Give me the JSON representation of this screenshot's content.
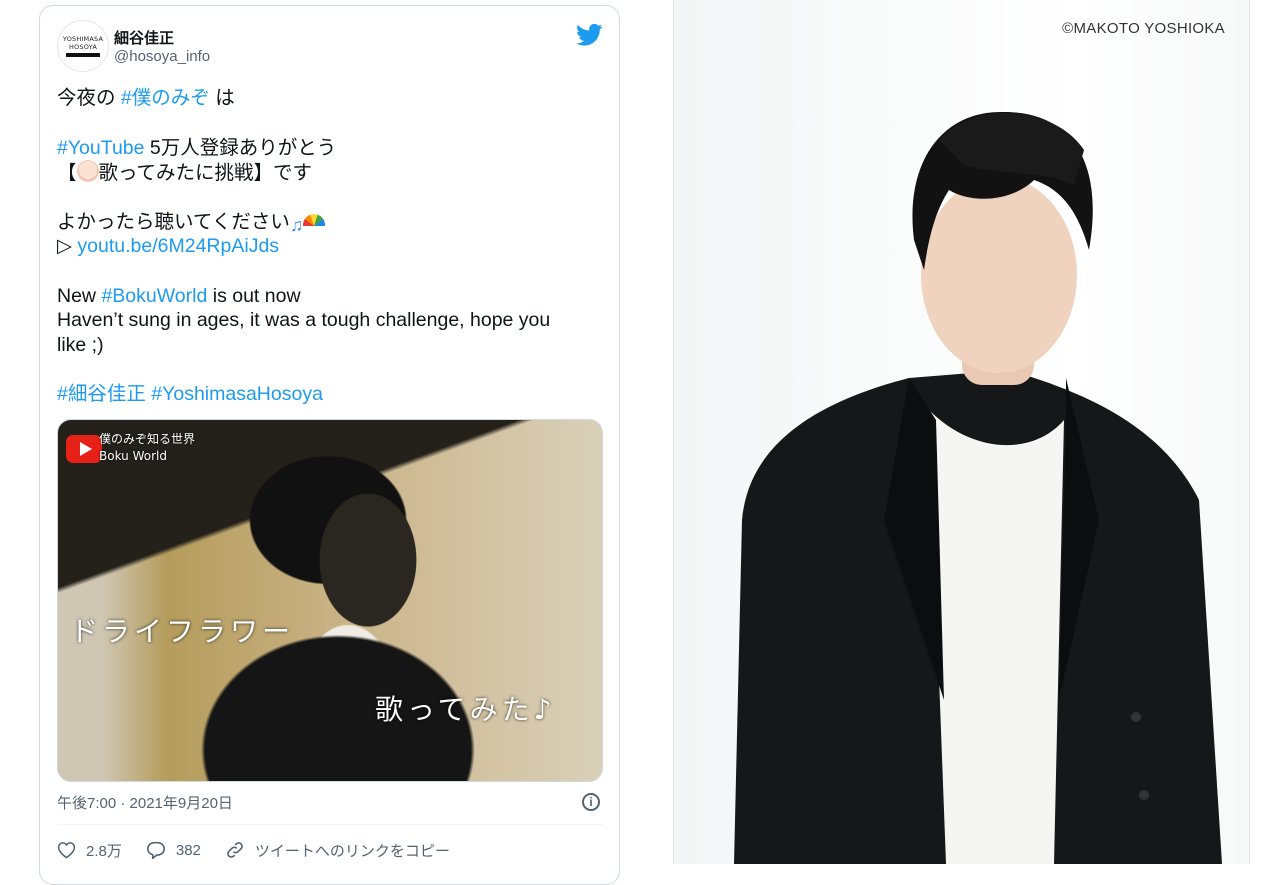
{
  "tweet": {
    "avatar": {
      "line1": "YOSHIMASA",
      "line2": "HOSOYA"
    },
    "display_name": "細谷佳正",
    "handle": "@hosoya_info",
    "lines": [
      {
        "parts": [
          {
            "t": "今夜の "
          },
          {
            "t": "#僕のみぞ",
            "link": true
          },
          {
            "t": " は"
          }
        ]
      },
      {
        "blank": true
      },
      {
        "parts": [
          {
            "t": "#YouTube",
            "link": true
          },
          {
            "t": " 5万人登録ありがとう"
          }
        ]
      },
      {
        "parts": [
          {
            "t": "【"
          },
          {
            "emoji": "baby-face"
          },
          {
            "t": "歌ってみたに挑戦】です"
          }
        ]
      },
      {
        "blank": true
      },
      {
        "parts": [
          {
            "t": "よかったら聴いてください"
          },
          {
            "emoji": "music-notes"
          },
          {
            "emoji": "rainbow"
          }
        ]
      },
      {
        "parts": [
          {
            "t": "▷ "
          },
          {
            "t": "youtu.be/6M24RpAiJds",
            "link": true
          }
        ]
      },
      {
        "blank": true
      },
      {
        "parts": [
          {
            "t": "New "
          },
          {
            "t": "#BokuWorld",
            "link": true
          },
          {
            "t": " is out now"
          }
        ]
      },
      {
        "parts": [
          {
            "t": "Haven’t sung in ages, it was a tough challenge, hope you"
          }
        ]
      },
      {
        "parts": [
          {
            "t": "like ;)"
          }
        ]
      },
      {
        "blank": true
      },
      {
        "parts": [
          {
            "t": "#細谷佳正",
            "link": true
          },
          {
            "t": " "
          },
          {
            "t": "#YoshimasaHosoya",
            "link": true
          }
        ]
      }
    ],
    "media": {
      "channel_line1": "僕のみぞ知る世界",
      "channel_line2": "Boku World",
      "song_title": "ドライフラワー",
      "caption": "歌ってみた♪"
    },
    "timestamp": "午後7:00 · 2021年9月20日",
    "actions": {
      "likes": "2.8万",
      "replies": "382",
      "copy_link": "ツイートへのリンクをコピー"
    }
  },
  "photo": {
    "credit": "©MAKOTO YOSHIOKA"
  },
  "colors": {
    "link": "#1d9bf0",
    "secondary": "#536471",
    "border": "#cfd9de",
    "twitter_blue": "#1d9bf0"
  }
}
